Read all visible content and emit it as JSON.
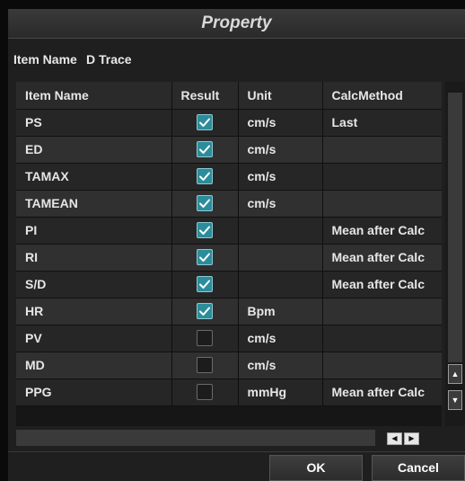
{
  "dialog": {
    "title": "Property"
  },
  "item": {
    "label": "Item Name",
    "value": "D Trace"
  },
  "table": {
    "columns": [
      "Item Name",
      "Result",
      "Unit",
      "CalcMethod"
    ],
    "rows": [
      {
        "name": "PS",
        "checked": true,
        "unit": "cm/s",
        "method": "Last"
      },
      {
        "name": "ED",
        "checked": true,
        "unit": "cm/s",
        "method": ""
      },
      {
        "name": "TAMAX",
        "checked": true,
        "unit": "cm/s",
        "method": ""
      },
      {
        "name": "TAMEAN",
        "checked": true,
        "unit": "cm/s",
        "method": ""
      },
      {
        "name": "PI",
        "checked": true,
        "unit": "",
        "method": "Mean after Calc"
      },
      {
        "name": "RI",
        "checked": true,
        "unit": "",
        "method": "Mean after Calc"
      },
      {
        "name": "S/D",
        "checked": true,
        "unit": "",
        "method": "Mean after Calc"
      },
      {
        "name": "HR",
        "checked": true,
        "unit": "Bpm",
        "method": ""
      },
      {
        "name": "PV",
        "checked": false,
        "unit": "cm/s",
        "method": ""
      },
      {
        "name": "MD",
        "checked": false,
        "unit": "cm/s",
        "method": ""
      },
      {
        "name": "PPG",
        "checked": false,
        "unit": "mmHg",
        "method": "Mean after Calc"
      }
    ]
  },
  "footer": {
    "ok_label": "OK",
    "cancel_label": "Cancel"
  },
  "icons": {
    "scroll_up": "up-arrow-icon",
    "scroll_down": "down-arrow-icon",
    "scroll_left": "left-arrow-icon",
    "scroll_right": "right-arrow-icon",
    "checkbox": "check-icon"
  },
  "colors": {
    "checkbox_on": "#2b8d9b",
    "title_bar": "#2f2f2f",
    "background": "#1f1f1f"
  }
}
